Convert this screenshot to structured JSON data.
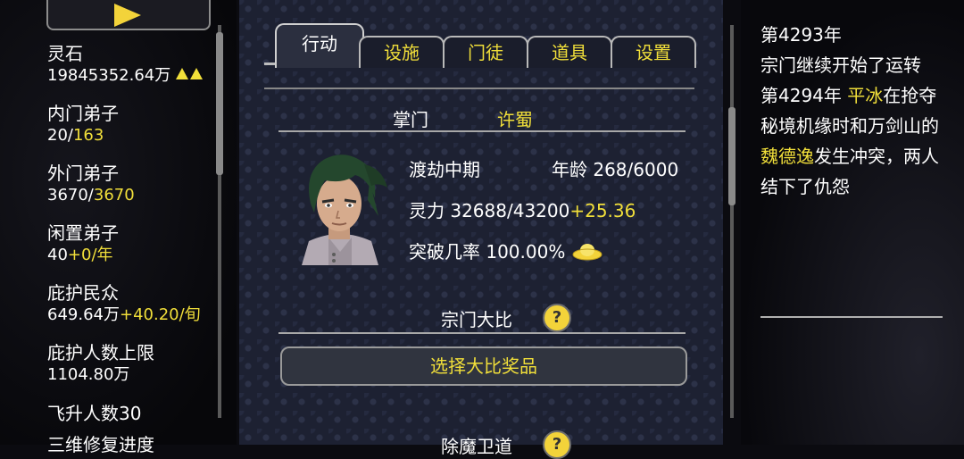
{
  "left": {
    "stats": [
      {
        "label": "灵石",
        "value": "19845352.64万",
        "extra": ""
      },
      {
        "label": "内门弟子",
        "value": "20/",
        "extra": "163"
      },
      {
        "label": "外门弟子",
        "value": "3670/",
        "extra": "3670"
      },
      {
        "label": "闲置弟子",
        "value": "40",
        "extra": "+0/年"
      },
      {
        "label": "庇护民众",
        "value": "649.64万",
        "extra": "+40.20/旬"
      },
      {
        "label": "庇护人数上限",
        "value": "",
        "extra": "1104.80万"
      },
      {
        "label": "飞升人数30",
        "value": "",
        "extra": ""
      },
      {
        "label": "三维修复进度",
        "value": "",
        "extra": ""
      }
    ]
  },
  "tabs": [
    "行动",
    "设施",
    "门徒",
    "道具",
    "设置"
  ],
  "leader": {
    "title_label": "掌门",
    "name": "许蜀",
    "realm": "渡劫中期",
    "age_label": "年龄",
    "age": "268/6000",
    "spirit_label": "灵力",
    "spirit": "32688/43200",
    "spirit_rate": "+25.36",
    "breakthrough_label": "突破几率",
    "breakthrough": "100.00%"
  },
  "contest": {
    "label": "宗门大比",
    "help": "?",
    "select_button": "选择大比奖品"
  },
  "next_section": {
    "label": "除魔卫道",
    "help": "?"
  },
  "log": {
    "line1": "第4293年",
    "line2": "宗门继续开始了运转",
    "line3_prefix": "第4294年",
    "name1": "平冰",
    "line3_mid": "在抢夺秘境机缘时和万剑山的",
    "name2": "魏德逸",
    "line3_suffix": "发生冲突，两人结下了仇怨"
  },
  "colors": {
    "accent": "#f1df3a",
    "panel": "#1d2132"
  }
}
